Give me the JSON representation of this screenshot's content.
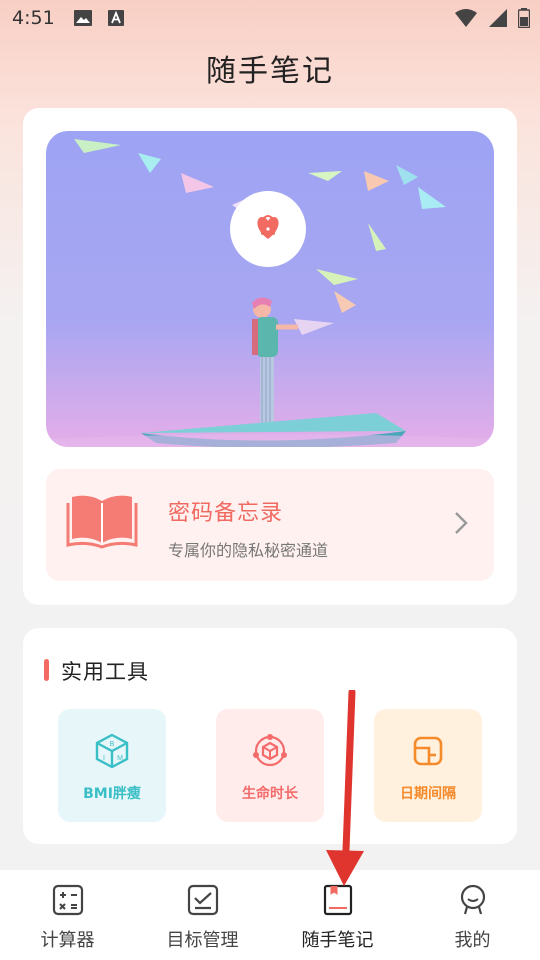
{
  "status_bar": {
    "time": "4:51"
  },
  "header": {
    "title": "随手笔记"
  },
  "memo": {
    "title": "密码备忘录",
    "subtitle": "专属你的隐私秘密通道"
  },
  "tools": {
    "section_title": "实用工具",
    "items": [
      {
        "label": "BMI胖瘦",
        "icon": "bmi-cube-icon"
      },
      {
        "label": "生命时长",
        "icon": "life-orbit-icon"
      },
      {
        "label": "日期间隔",
        "icon": "date-interval-icon"
      }
    ]
  },
  "tab_bar": {
    "items": [
      {
        "label": "计算器",
        "icon": "calculator-icon"
      },
      {
        "label": "目标管理",
        "icon": "checklist-icon"
      },
      {
        "label": "随手笔记",
        "icon": "notebook-icon",
        "active": true
      },
      {
        "label": "我的",
        "icon": "profile-icon"
      }
    ]
  },
  "colors": {
    "accent": "#f06a62",
    "bmi": "#3bbfc7",
    "life": "#f36b6b",
    "date": "#f58a2b",
    "annotation_arrow": "#e0352f"
  }
}
